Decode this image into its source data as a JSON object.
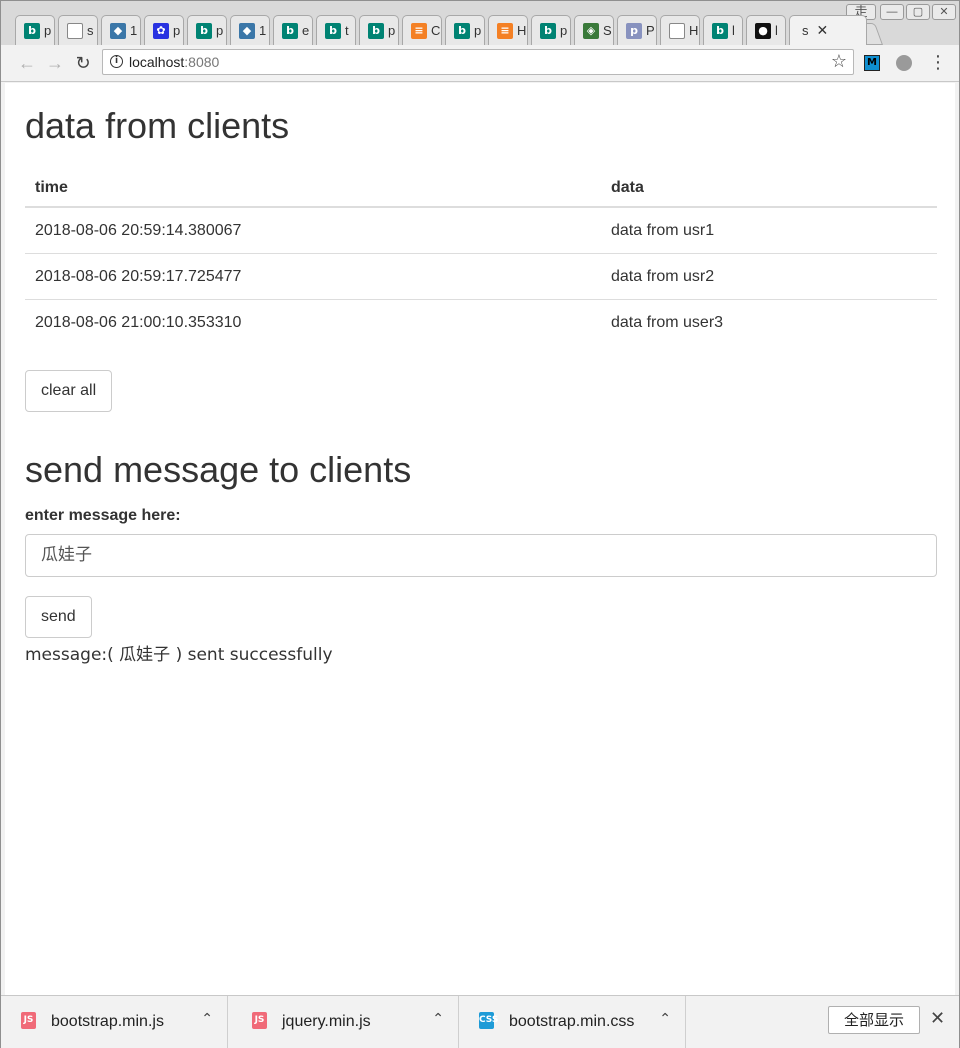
{
  "browser": {
    "tabs": [
      {
        "icon": "bing-icon",
        "title": "p",
        "color": "#008373"
      },
      {
        "icon": "page-icon",
        "title": "s",
        "color": "#ffffff"
      },
      {
        "icon": "python-icon",
        "title": "1",
        "color": "#3b77a8"
      },
      {
        "icon": "baidu-icon",
        "title": "p",
        "color": "#2932e1"
      },
      {
        "icon": "bing-icon",
        "title": "p",
        "color": "#008373"
      },
      {
        "icon": "python-icon",
        "title": "1",
        "color": "#3b77a8"
      },
      {
        "icon": "bing-icon",
        "title": "e",
        "color": "#008373"
      },
      {
        "icon": "bing-icon",
        "title": "t",
        "color": "#008373"
      },
      {
        "icon": "bing-icon",
        "title": "p",
        "color": "#008373"
      },
      {
        "icon": "stackoverflow-icon",
        "title": "C",
        "color": "#f48024"
      },
      {
        "icon": "bing-icon",
        "title": "p",
        "color": "#008373"
      },
      {
        "icon": "stackoverflow-icon",
        "title": "H",
        "color": "#f48024"
      },
      {
        "icon": "bing-icon",
        "title": "p",
        "color": "#008373"
      },
      {
        "icon": "diamond-icon",
        "title": "S",
        "color": "#3a7a3a"
      },
      {
        "icon": "php-icon",
        "title": "P",
        "color": "#8892bf"
      },
      {
        "icon": "page-icon",
        "title": "H",
        "color": "#ffffff"
      },
      {
        "icon": "bing-icon",
        "title": "l",
        "color": "#008373"
      },
      {
        "icon": "github-icon",
        "title": "l",
        "color": "#111111"
      }
    ],
    "active_tab": {
      "title": "s",
      "close": "✕"
    },
    "url_host": "localhost",
    "url_port": ":8080",
    "window_controls": {
      "ime": "走"
    }
  },
  "page": {
    "clients_heading": "data from clients",
    "table": {
      "headers": [
        "time",
        "data"
      ],
      "rows": [
        [
          "2018-08-06 20:59:14.380067",
          "data from usr1"
        ],
        [
          "2018-08-06 20:59:17.725477",
          "data from usr2"
        ],
        [
          "2018-08-06 21:00:10.353310",
          "data from user3"
        ]
      ]
    },
    "clear_button": "clear all",
    "send_heading": "send message to clients",
    "message_label": "enter message here:",
    "message_value": "瓜娃子",
    "send_button": "send",
    "status_text": "message:( 瓜娃子 ) sent successfully"
  },
  "downloads": {
    "items": [
      {
        "name": "bootstrap.min.js",
        "icon": "js-file-icon",
        "color": "#f06a78"
      },
      {
        "name": "jquery.min.js",
        "icon": "js-file-icon",
        "color": "#f06a78"
      },
      {
        "name": "bootstrap.min.css",
        "icon": "css-file-icon",
        "color": "#1e9bd7"
      }
    ],
    "show_all": "全部显示",
    "close": "✕"
  }
}
